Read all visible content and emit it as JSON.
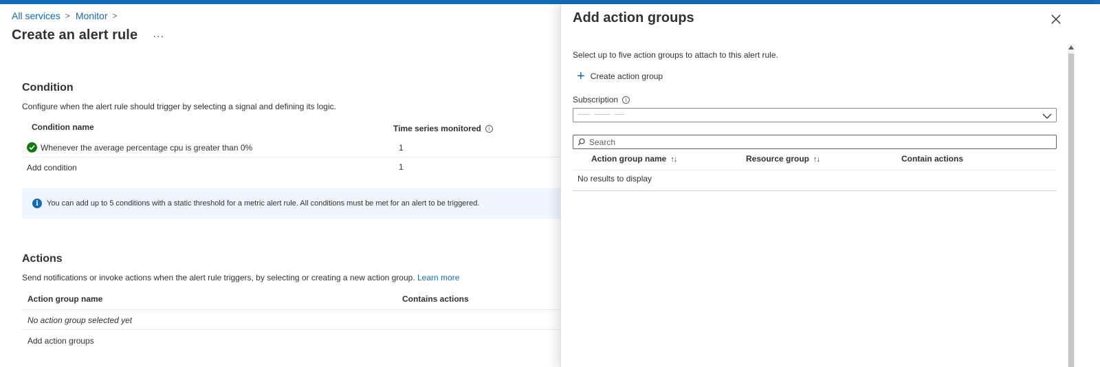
{
  "breadcrumb": {
    "items": [
      "All services",
      "Monitor"
    ],
    "separator": ">"
  },
  "page": {
    "title": "Create an alert rule",
    "more_label": "···"
  },
  "condition": {
    "title": "Condition",
    "description": "Configure when the alert rule should trigger by selecting a signal and defining its logic.",
    "columns": [
      "Condition name",
      "Time series monitored"
    ],
    "rows": [
      {
        "name": "Whenever the average percentage cpu is greater than 0%",
        "time_series": "1",
        "status_icon": "success-check-icon"
      },
      {
        "name": "Add condition",
        "time_series": "1"
      }
    ],
    "info_text": "You can add up to 5 conditions with a static threshold for a metric alert rule. All conditions must be met for an alert to be triggered."
  },
  "actions": {
    "title": "Actions",
    "description": "Send notifications or invoke actions when the alert rule triggers, by selecting or creating a new action group.",
    "learn_more": "Learn more",
    "columns": [
      "Action group name",
      "Contains actions"
    ],
    "empty_text": "No action group selected yet",
    "add_label": "Add action groups"
  },
  "panel": {
    "title": "Add action groups",
    "description": "Select up to five action groups to attach to this alert rule.",
    "create_label": "Create action group",
    "subscription_label": "Subscription",
    "search_placeholder": "Search",
    "columns": [
      "Action group name",
      "Resource group",
      "Contain actions"
    ],
    "empty_text": "No results to display"
  },
  "colors": {
    "accent": "#0f6cbd",
    "success": "#107c10",
    "info_bg": "#f0f6ff"
  }
}
